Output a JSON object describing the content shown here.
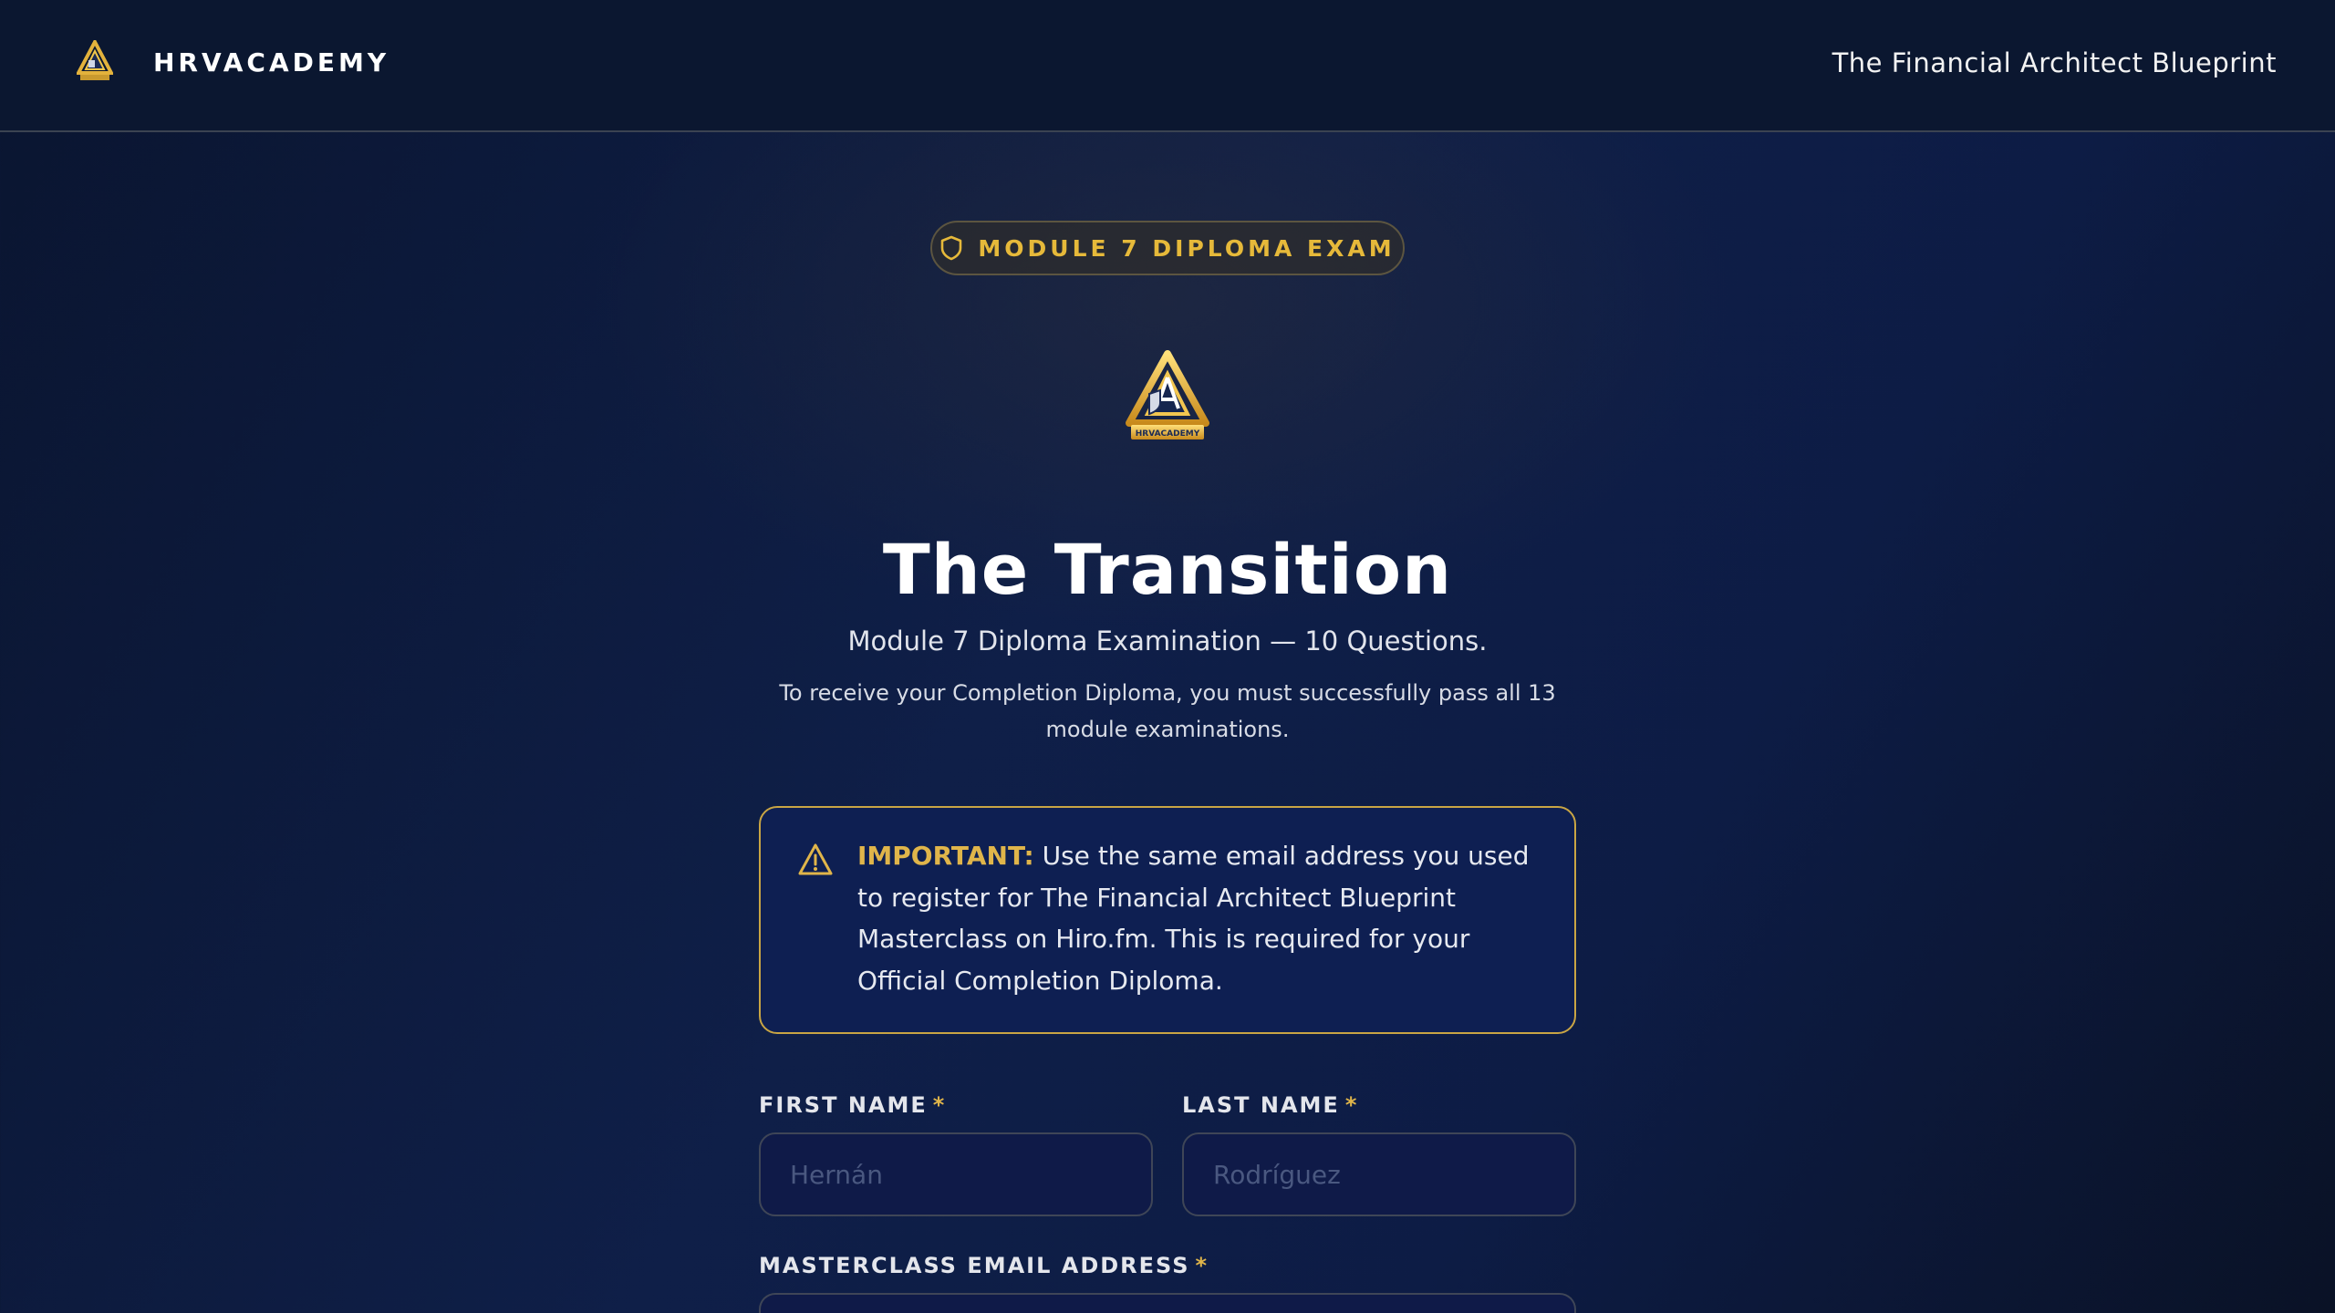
{
  "header": {
    "brand": "HRVACADEMY",
    "course_title": "The Financial Architect Blueprint"
  },
  "badge": {
    "icon": "shield-icon",
    "label": "MODULE 7 DIPLOMA EXAM"
  },
  "logo": {
    "text": "HRVACADEMY"
  },
  "hero": {
    "title": "The Transition",
    "subtitle": "Module 7 Diploma Examination — 10 Questions.",
    "description": "To receive your Completion Diploma, you must successfully pass all 13 module examinations."
  },
  "notice": {
    "icon": "warning-icon",
    "strong": "IMPORTANT:",
    "text": " Use the same email address you used to register for The Financial Architect Blueprint Masterclass on Hiro.fm. This is required for your Official Completion Diploma."
  },
  "form": {
    "first_name": {
      "label": "FIRST NAME",
      "required_mark": "*",
      "placeholder": "Hernán",
      "value": ""
    },
    "last_name": {
      "label": "LAST NAME",
      "required_mark": "*",
      "placeholder": "Rodríguez",
      "value": ""
    },
    "email": {
      "label": "MASTERCLASS EMAIL ADDRESS",
      "required_mark": "*"
    }
  },
  "colors": {
    "accent_gold": "#e0b54a",
    "background": "#0f1f48",
    "header": "#0b1730",
    "notice_bg": "#0e1f52"
  }
}
